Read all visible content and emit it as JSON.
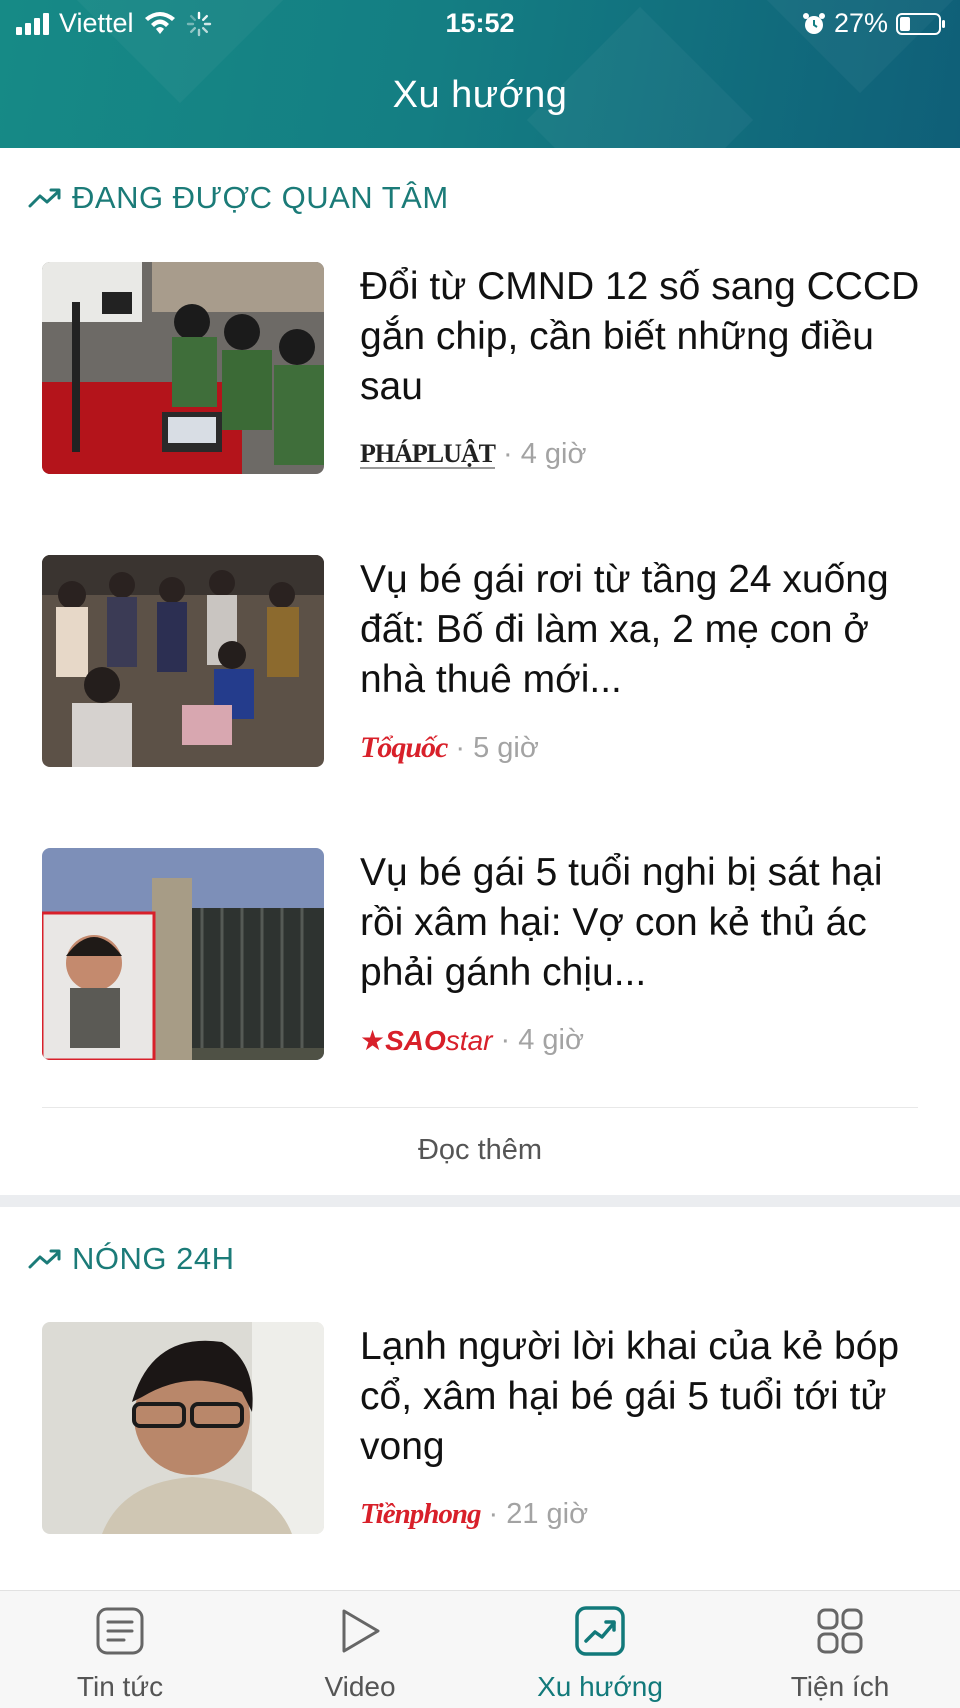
{
  "status_bar": {
    "carrier": "Viettel",
    "time": "15:52",
    "battery": "27%",
    "battery_level": 0.27
  },
  "header": {
    "title": "Xu hướng"
  },
  "sections": [
    {
      "heading": "ĐANG ĐƯỢC QUAN TÂM",
      "icon": "trending-up-icon",
      "articles": [
        {
          "title": "Đổi từ CMND 12 số sang CCCD gắn chip, cần biết những điều sau",
          "source": "PHÁPLUẬT",
          "age": "4 giờ"
        },
        {
          "title": "Vụ bé gái rơi từ tầng 24 xuống đất: Bố đi làm xa, 2 mẹ con ở nhà thuê mới...",
          "source": "Tổquốc",
          "age": "5 giờ"
        },
        {
          "title": "Vụ bé gái 5 tuổi nghi bị sát hại rồi xâm hại: Vợ con kẻ thủ ác phải gánh chịu...",
          "source_main": "SAO",
          "source_suffix": "star",
          "age": "4 giờ"
        }
      ],
      "read_more": "Đọc thêm"
    },
    {
      "heading": "NÓNG 24H",
      "icon": "trending-up-icon",
      "articles": [
        {
          "title": "Lạnh người lời khai của kẻ bóp cổ, xâm hại bé gái 5 tuổi tới tử vong",
          "source": "Tiềnphong",
          "age": "21 giờ"
        }
      ]
    }
  ],
  "separator": "·",
  "tabs": [
    {
      "label": "Tin tức",
      "icon": "news-icon"
    },
    {
      "label": "Video",
      "icon": "play-icon"
    },
    {
      "label": "Xu hướng",
      "icon": "trending-chart-icon",
      "active": true
    },
    {
      "label": "Tiện ích",
      "icon": "grid-icon"
    }
  ],
  "colors": {
    "accent": "#1b7b78",
    "header_start": "#168a86",
    "header_end": "#0f5f78",
    "source_red": "#d8202a"
  }
}
